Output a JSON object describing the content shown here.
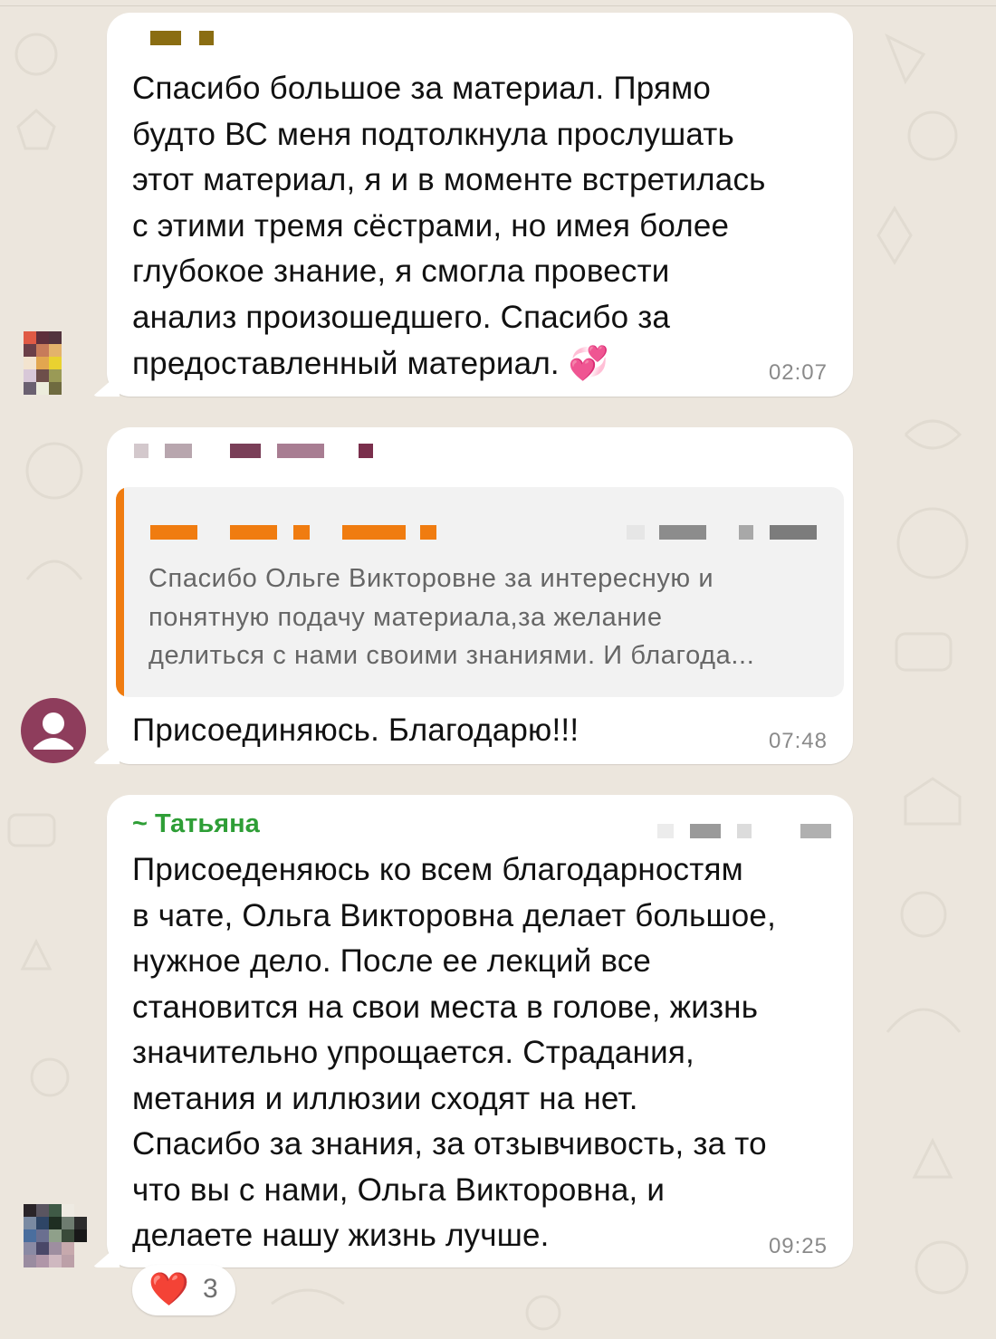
{
  "messages": [
    {
      "text": "Спасибо большое за материал. Прямо\nбудто ВС меня подтолкнула прослушать\nэтот материал, я и в моменте встретилась\nс этими тремя сёстрами, но имея более\nглубокое знание, я смогла провести\nанализ произошедшего. Спасибо за\nпредоставленный материал.",
      "emoji": "💞",
      "time": "02:07"
    },
    {
      "quote": {
        "text": "Спасибо Ольге Викторовне за интересную и\nпонятную подачу материала,за желание\nделиться с нами своими знаниями. И благода..."
      },
      "text": "Присоединяюсь. Благодарю!!!",
      "time": "07:48"
    },
    {
      "sender": "~ Татьяна",
      "text": "Присоеденяюсь ко всем благодарностям\nв чате, Ольга Викторовна делает большое,\nнужное дело. После ее лекций все\nстановится на свои места в голове, жизнь\nзначительно упрощается. Страдания,\nметания и иллюзии сходят на нет.\nСпасибо за знания, за отзывчивость, за то\nчто вы с нами, Ольга Викторовна, и\nделаете нашу жизнь лучше.",
      "time": "09:25",
      "reaction": {
        "emoji": "❤️",
        "count": "3"
      }
    }
  ],
  "colors": {
    "background": "#ece6dd",
    "bubble": "#ffffff",
    "quote_accent": "#f07c10",
    "sender_name": "#2e9e36",
    "default_avatar": "#8e3d5c"
  },
  "icons": {
    "avatar_default": "person-icon",
    "reaction": "heart-icon"
  }
}
